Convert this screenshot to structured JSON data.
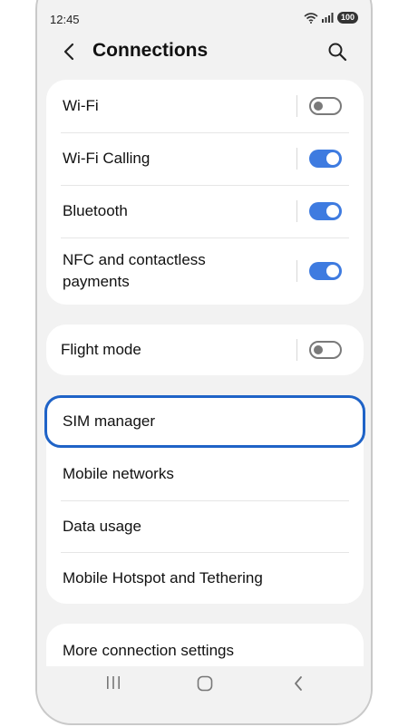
{
  "status_bar": {
    "time": "12:45",
    "battery": "100",
    "icons": [
      "wifi-icon",
      "signal-icon",
      "battery-icon"
    ]
  },
  "header": {
    "title": "Connections",
    "back_icon": "back-icon",
    "search_icon": "search-icon"
  },
  "group1": {
    "items": [
      {
        "label": "Wi-Fi",
        "toggle": false
      },
      {
        "label": "Wi-Fi Calling",
        "toggle": true
      },
      {
        "label": "Bluetooth",
        "toggle": true
      },
      {
        "label": "NFC and contactless payments",
        "toggle": true
      }
    ]
  },
  "group2": {
    "items": [
      {
        "label": "Flight mode",
        "toggle": false
      }
    ]
  },
  "group3": {
    "items": [
      {
        "label": "SIM manager",
        "focused": true
      },
      {
        "label": "Mobile networks"
      },
      {
        "label": "Data usage"
      },
      {
        "label": "Mobile Hotspot and Tethering"
      }
    ]
  },
  "group4": {
    "items": [
      {
        "label": "More connection settings"
      }
    ]
  },
  "nav": {
    "icons": [
      "recent-apps-icon",
      "home-icon",
      "back-nav-icon"
    ]
  },
  "colors": {
    "accent": "#3e7be0",
    "focus": "#1f63c7",
    "background": "#f2f2f2",
    "card": "#ffffff"
  }
}
